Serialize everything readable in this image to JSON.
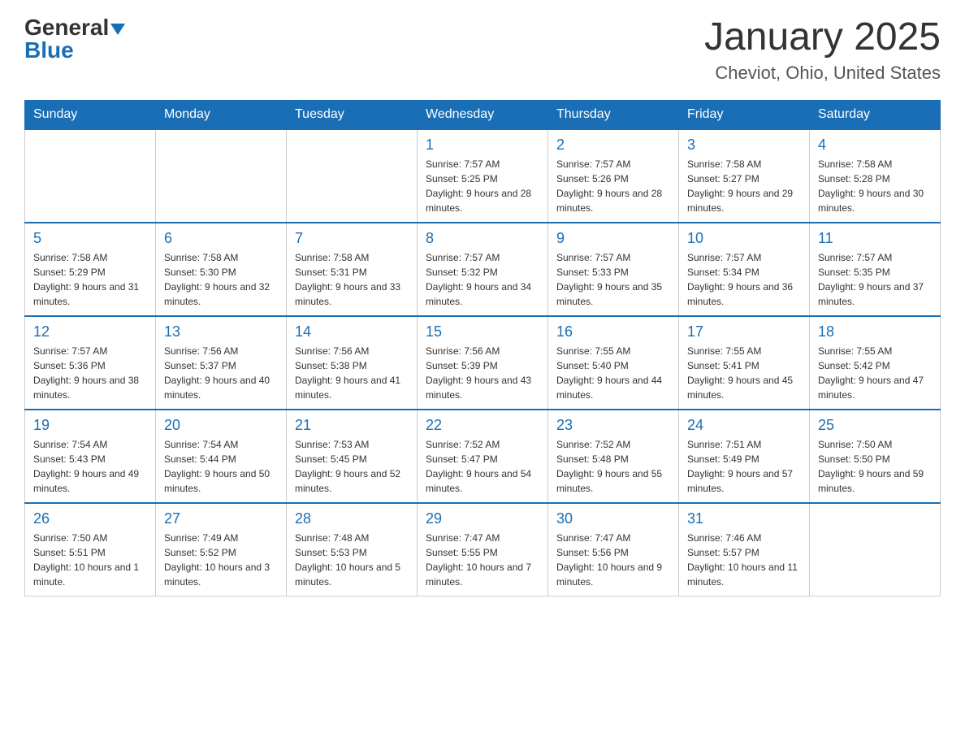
{
  "header": {
    "logo_general": "General",
    "logo_blue": "Blue",
    "month_title": "January 2025",
    "location": "Cheviot, Ohio, United States"
  },
  "weekdays": [
    "Sunday",
    "Monday",
    "Tuesday",
    "Wednesday",
    "Thursday",
    "Friday",
    "Saturday"
  ],
  "weeks": [
    [
      {
        "day": "",
        "info": ""
      },
      {
        "day": "",
        "info": ""
      },
      {
        "day": "",
        "info": ""
      },
      {
        "day": "1",
        "info": "Sunrise: 7:57 AM\nSunset: 5:25 PM\nDaylight: 9 hours and 28 minutes."
      },
      {
        "day": "2",
        "info": "Sunrise: 7:57 AM\nSunset: 5:26 PM\nDaylight: 9 hours and 28 minutes."
      },
      {
        "day": "3",
        "info": "Sunrise: 7:58 AM\nSunset: 5:27 PM\nDaylight: 9 hours and 29 minutes."
      },
      {
        "day": "4",
        "info": "Sunrise: 7:58 AM\nSunset: 5:28 PM\nDaylight: 9 hours and 30 minutes."
      }
    ],
    [
      {
        "day": "5",
        "info": "Sunrise: 7:58 AM\nSunset: 5:29 PM\nDaylight: 9 hours and 31 minutes."
      },
      {
        "day": "6",
        "info": "Sunrise: 7:58 AM\nSunset: 5:30 PM\nDaylight: 9 hours and 32 minutes."
      },
      {
        "day": "7",
        "info": "Sunrise: 7:58 AM\nSunset: 5:31 PM\nDaylight: 9 hours and 33 minutes."
      },
      {
        "day": "8",
        "info": "Sunrise: 7:57 AM\nSunset: 5:32 PM\nDaylight: 9 hours and 34 minutes."
      },
      {
        "day": "9",
        "info": "Sunrise: 7:57 AM\nSunset: 5:33 PM\nDaylight: 9 hours and 35 minutes."
      },
      {
        "day": "10",
        "info": "Sunrise: 7:57 AM\nSunset: 5:34 PM\nDaylight: 9 hours and 36 minutes."
      },
      {
        "day": "11",
        "info": "Sunrise: 7:57 AM\nSunset: 5:35 PM\nDaylight: 9 hours and 37 minutes."
      }
    ],
    [
      {
        "day": "12",
        "info": "Sunrise: 7:57 AM\nSunset: 5:36 PM\nDaylight: 9 hours and 38 minutes."
      },
      {
        "day": "13",
        "info": "Sunrise: 7:56 AM\nSunset: 5:37 PM\nDaylight: 9 hours and 40 minutes."
      },
      {
        "day": "14",
        "info": "Sunrise: 7:56 AM\nSunset: 5:38 PM\nDaylight: 9 hours and 41 minutes."
      },
      {
        "day": "15",
        "info": "Sunrise: 7:56 AM\nSunset: 5:39 PM\nDaylight: 9 hours and 43 minutes."
      },
      {
        "day": "16",
        "info": "Sunrise: 7:55 AM\nSunset: 5:40 PM\nDaylight: 9 hours and 44 minutes."
      },
      {
        "day": "17",
        "info": "Sunrise: 7:55 AM\nSunset: 5:41 PM\nDaylight: 9 hours and 45 minutes."
      },
      {
        "day": "18",
        "info": "Sunrise: 7:55 AM\nSunset: 5:42 PM\nDaylight: 9 hours and 47 minutes."
      }
    ],
    [
      {
        "day": "19",
        "info": "Sunrise: 7:54 AM\nSunset: 5:43 PM\nDaylight: 9 hours and 49 minutes."
      },
      {
        "day": "20",
        "info": "Sunrise: 7:54 AM\nSunset: 5:44 PM\nDaylight: 9 hours and 50 minutes."
      },
      {
        "day": "21",
        "info": "Sunrise: 7:53 AM\nSunset: 5:45 PM\nDaylight: 9 hours and 52 minutes."
      },
      {
        "day": "22",
        "info": "Sunrise: 7:52 AM\nSunset: 5:47 PM\nDaylight: 9 hours and 54 minutes."
      },
      {
        "day": "23",
        "info": "Sunrise: 7:52 AM\nSunset: 5:48 PM\nDaylight: 9 hours and 55 minutes."
      },
      {
        "day": "24",
        "info": "Sunrise: 7:51 AM\nSunset: 5:49 PM\nDaylight: 9 hours and 57 minutes."
      },
      {
        "day": "25",
        "info": "Sunrise: 7:50 AM\nSunset: 5:50 PM\nDaylight: 9 hours and 59 minutes."
      }
    ],
    [
      {
        "day": "26",
        "info": "Sunrise: 7:50 AM\nSunset: 5:51 PM\nDaylight: 10 hours and 1 minute."
      },
      {
        "day": "27",
        "info": "Sunrise: 7:49 AM\nSunset: 5:52 PM\nDaylight: 10 hours and 3 minutes."
      },
      {
        "day": "28",
        "info": "Sunrise: 7:48 AM\nSunset: 5:53 PM\nDaylight: 10 hours and 5 minutes."
      },
      {
        "day": "29",
        "info": "Sunrise: 7:47 AM\nSunset: 5:55 PM\nDaylight: 10 hours and 7 minutes."
      },
      {
        "day": "30",
        "info": "Sunrise: 7:47 AM\nSunset: 5:56 PM\nDaylight: 10 hours and 9 minutes."
      },
      {
        "day": "31",
        "info": "Sunrise: 7:46 AM\nSunset: 5:57 PM\nDaylight: 10 hours and 11 minutes."
      },
      {
        "day": "",
        "info": ""
      }
    ]
  ]
}
